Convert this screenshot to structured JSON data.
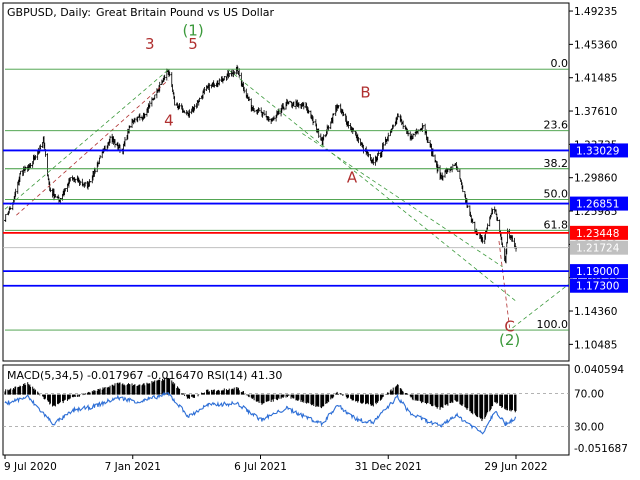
{
  "title": {
    "symbol": "GBPUSD, Daily:",
    "description": "Great Britain Pound vs US Dollar"
  },
  "chart_data": {
    "type": "line",
    "series_kind": "OHLC bars (daily)",
    "x_start": "2020-07-09",
    "x_end": "2022-06-29",
    "x_tick_labels": [
      "9 Jul 2020",
      "7 Jan 2021",
      "6 Jul 2021",
      "31 Dec 2021",
      "29 Jun 2022"
    ],
    "y_tick_labels": [
      "1.49235",
      "1.45360",
      "1.41485",
      "1.37610",
      "1.33735",
      "1.29860",
      "1.25985",
      "1.22110",
      "1.18235",
      "1.14360",
      "1.10485"
    ],
    "ylim": [
      1.0855,
      1.5017
    ],
    "price_path": [
      {
        "date": "2020-07-09",
        "price": 1.252
      },
      {
        "date": "2020-07-20",
        "price": 1.268
      },
      {
        "date": "2020-07-31",
        "price": 1.305
      },
      {
        "date": "2020-08-14",
        "price": 1.312
      },
      {
        "date": "2020-09-01",
        "price": 1.342
      },
      {
        "date": "2020-09-10",
        "price": 1.285
      },
      {
        "date": "2020-09-23",
        "price": 1.272
      },
      {
        "date": "2020-10-10",
        "price": 1.298
      },
      {
        "date": "2020-11-02",
        "price": 1.289
      },
      {
        "date": "2020-12-04",
        "price": 1.345
      },
      {
        "date": "2020-12-21",
        "price": 1.33
      },
      {
        "date": "2021-01-04",
        "price": 1.365
      },
      {
        "date": "2021-01-22",
        "price": 1.371
      },
      {
        "date": "2021-02-24",
        "price": 1.424
      },
      {
        "date": "2021-03-05",
        "price": 1.385
      },
      {
        "date": "2021-03-25",
        "price": 1.372
      },
      {
        "date": "2021-04-20",
        "price": 1.403
      },
      {
        "date": "2021-06-01",
        "price": 1.424
      },
      {
        "date": "2021-06-20",
        "price": 1.382
      },
      {
        "date": "2021-07-20",
        "price": 1.364
      },
      {
        "date": "2021-08-10",
        "price": 1.385
      },
      {
        "date": "2021-09-06",
        "price": 1.382
      },
      {
        "date": "2021-09-29",
        "price": 1.341
      },
      {
        "date": "2021-10-20",
        "price": 1.382
      },
      {
        "date": "2021-11-18",
        "price": 1.344
      },
      {
        "date": "2021-12-08",
        "price": 1.316
      },
      {
        "date": "2021-12-20",
        "price": 1.327
      },
      {
        "date": "2022-01-04",
        "price": 1.355
      },
      {
        "date": "2022-01-13",
        "price": 1.371
      },
      {
        "date": "2022-01-31",
        "price": 1.344
      },
      {
        "date": "2022-02-18",
        "price": 1.36
      },
      {
        "date": "2022-03-14",
        "price": 1.3
      },
      {
        "date": "2022-04-05",
        "price": 1.313
      },
      {
        "date": "2022-04-28",
        "price": 1.246
      },
      {
        "date": "2022-05-13",
        "price": 1.223
      },
      {
        "date": "2022-05-27",
        "price": 1.263
      },
      {
        "date": "2022-06-01",
        "price": 1.257
      },
      {
        "date": "2022-06-14",
        "price": 1.2
      },
      {
        "date": "2022-06-17",
        "price": 1.238
      },
      {
        "date": "2022-06-24",
        "price": 1.224
      },
      {
        "date": "2022-06-29",
        "price": 1.2172
      }
    ],
    "fibonacci": {
      "color": "#3c9a3c",
      "levels": [
        {
          "label": "0.0",
          "price": 1.4248
        },
        {
          "label": "23.6",
          "price": 1.3532
        },
        {
          "label": "38.2",
          "price": 1.309
        },
        {
          "label": "50.0",
          "price": 1.2732
        },
        {
          "label": "61.8",
          "price": 1.2374
        },
        {
          "label": "100.0",
          "price": 1.1215
        }
      ]
    },
    "horizontal_levels": [
      {
        "price": 1.33029,
        "label": "1.33029",
        "color": "#0000ff"
      },
      {
        "price": 1.26851,
        "label": "1.26851",
        "color": "#0000ff"
      },
      {
        "price": 1.23448,
        "label": "1.23448",
        "color": "#ff0000"
      },
      {
        "price": 1.21724,
        "label": "1.21724",
        "color": "#c0c0c0"
      },
      {
        "price": 1.19,
        "label": "1.19000",
        "color": "#0000ff"
      },
      {
        "price": 1.173,
        "label": "1.17300",
        "color": "#0000ff"
      }
    ],
    "wave_labels": [
      {
        "text": "3",
        "date": "2021-01-29",
        "price": 1.448,
        "color": "#b03030"
      },
      {
        "text": "4",
        "date": "2021-02-25",
        "price": 1.359,
        "color": "#b03030"
      },
      {
        "text": "5",
        "date": "2021-03-31",
        "price": 1.448,
        "color": "#b03030"
      },
      {
        "text": "(1)",
        "date": "2021-03-31",
        "price": 1.464,
        "color": "#3c9a3c"
      },
      {
        "text": "B",
        "date": "2021-11-29",
        "price": 1.392,
        "color": "#b03030"
      },
      {
        "text": "A",
        "date": "2021-11-10",
        "price": 1.293,
        "color": "#b03030"
      },
      {
        "text": "C",
        "date": "2022-06-20",
        "price": 1.12,
        "color": "#b03030"
      },
      {
        "text": "(2)",
        "date": "2022-06-20",
        "price": 1.104,
        "color": "#3c9a3c"
      }
    ],
    "indicator": {
      "title": "MACD(5,34,5) -0.017967 -0.016470 RSI(14) 41.30",
      "left_tick_labels": [
        "0.040594",
        "-0.051687"
      ],
      "rsi_tick_labels": [
        "70.00",
        "30.00"
      ],
      "rsi_levels": [
        70,
        30
      ],
      "ylim": [
        -0.051687,
        0.040594
      ],
      "macd_path": [
        {
          "date": "2020-07-09",
          "value": 0.004
        },
        {
          "date": "2020-08-10",
          "value": 0.012
        },
        {
          "date": "2020-09-15",
          "value": -0.013
        },
        {
          "date": "2020-10-15",
          "value": -0.002
        },
        {
          "date": "2020-11-10",
          "value": 0.003
        },
        {
          "date": "2020-12-15",
          "value": 0.012
        },
        {
          "date": "2021-01-15",
          "value": 0.01
        },
        {
          "date": "2021-02-24",
          "value": 0.018
        },
        {
          "date": "2021-03-25",
          "value": -0.005
        },
        {
          "date": "2021-04-20",
          "value": 0.004
        },
        {
          "date": "2021-06-01",
          "value": 0.007
        },
        {
          "date": "2021-07-05",
          "value": -0.01
        },
        {
          "date": "2021-08-10",
          "value": -0.002
        },
        {
          "date": "2021-09-29",
          "value": -0.014
        },
        {
          "date": "2021-10-20",
          "value": 0.002
        },
        {
          "date": "2021-11-18",
          "value": -0.008
        },
        {
          "date": "2021-12-10",
          "value": -0.012
        },
        {
          "date": "2022-01-13",
          "value": 0.01
        },
        {
          "date": "2022-02-01",
          "value": -0.004
        },
        {
          "date": "2022-03-14",
          "value": -0.015
        },
        {
          "date": "2022-04-05",
          "value": -0.006
        },
        {
          "date": "2022-05-13",
          "value": -0.028
        },
        {
          "date": "2022-05-31",
          "value": -0.008
        },
        {
          "date": "2022-06-14",
          "value": -0.016
        },
        {
          "date": "2022-06-29",
          "value": -0.018
        }
      ],
      "rsi_path": [
        {
          "date": "2020-07-09",
          "value": 58
        },
        {
          "date": "2020-08-10",
          "value": 66
        },
        {
          "date": "2020-09-15",
          "value": 33
        },
        {
          "date": "2020-10-15",
          "value": 50
        },
        {
          "date": "2020-11-10",
          "value": 54
        },
        {
          "date": "2020-12-15",
          "value": 65
        },
        {
          "date": "2021-01-15",
          "value": 60
        },
        {
          "date": "2021-02-24",
          "value": 70
        },
        {
          "date": "2021-03-25",
          "value": 42
        },
        {
          "date": "2021-04-20",
          "value": 56
        },
        {
          "date": "2021-06-01",
          "value": 58
        },
        {
          "date": "2021-07-05",
          "value": 38
        },
        {
          "date": "2021-08-10",
          "value": 52
        },
        {
          "date": "2021-09-29",
          "value": 33
        },
        {
          "date": "2021-10-20",
          "value": 56
        },
        {
          "date": "2021-11-18",
          "value": 38
        },
        {
          "date": "2021-12-10",
          "value": 35
        },
        {
          "date": "2022-01-13",
          "value": 66
        },
        {
          "date": "2022-02-01",
          "value": 45
        },
        {
          "date": "2022-03-14",
          "value": 30
        },
        {
          "date": "2022-04-05",
          "value": 44
        },
        {
          "date": "2022-05-13",
          "value": 22
        },
        {
          "date": "2022-05-31",
          "value": 50
        },
        {
          "date": "2022-06-14",
          "value": 33
        },
        {
          "date": "2022-06-29",
          "value": 41
        }
      ]
    }
  }
}
